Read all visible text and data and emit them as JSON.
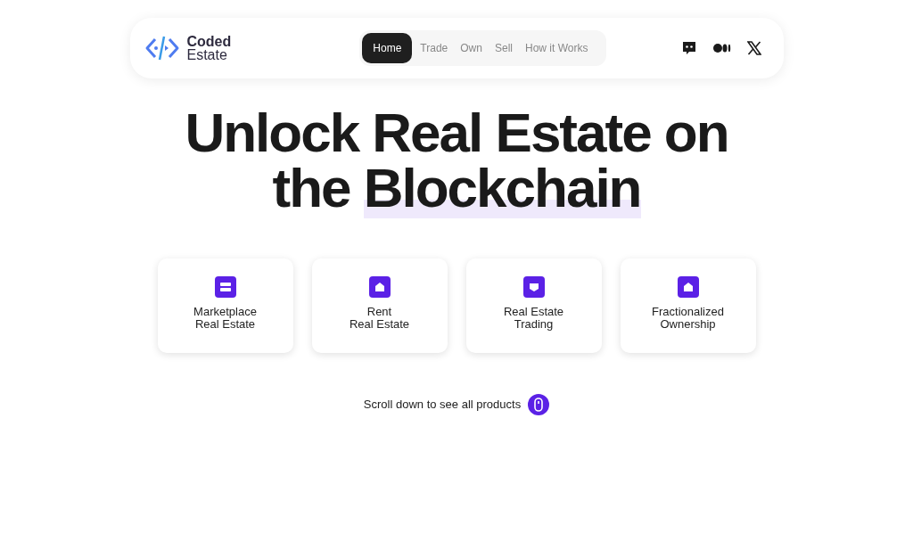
{
  "logo": {
    "line_1": "Coded",
    "line_2": "Estate"
  },
  "nav": [
    {
      "label": "Home",
      "selected": true
    },
    {
      "label": "Trade",
      "selected": false
    },
    {
      "label": "Own",
      "selected": false
    },
    {
      "label": "Sell",
      "selected": false
    },
    {
      "label": "How it Works",
      "selected": false
    }
  ],
  "headline": {
    "lead": "Unlock Real Estate on the",
    "highlight": "Blockchain"
  },
  "products": [
    {
      "line_1": "Marketplace",
      "line_2": "Real Estate"
    },
    {
      "line_1": "Rent",
      "line_2": "Real Estate"
    },
    {
      "line_1": "Real Estate",
      "line_2": "Trading"
    },
    {
      "line_1": "Fractionalized",
      "line_2": "Ownership"
    }
  ],
  "scroll_hint": "Scroll down to see all products"
}
